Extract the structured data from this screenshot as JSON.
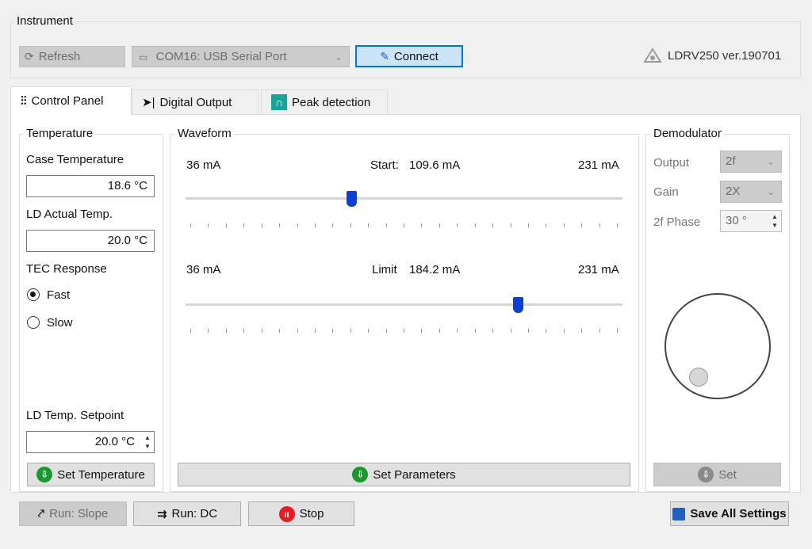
{
  "instrument": {
    "group_title": "Instrument",
    "refresh_label": "Refresh",
    "port_value": "COM16: USB Serial Port",
    "connect_label": "Connect",
    "device_version": "LDRV250 ver.190701"
  },
  "tabs": [
    {
      "label": "Control Panel",
      "icon": "sliders-icon",
      "active": true
    },
    {
      "label": "Digital Output",
      "icon": "diode-icon",
      "active": false
    },
    {
      "label": "Peak detection",
      "icon": "peak-icon",
      "active": false
    }
  ],
  "temperature": {
    "group_title": "Temperature",
    "case_label": "Case Temperature",
    "case_value": "18.6 °C",
    "ld_actual_label": "LD Actual Temp.",
    "ld_actual_value": "20.0 °C",
    "tec_label": "TEC Response",
    "tec_options": [
      "Fast",
      "Slow"
    ],
    "tec_selected": "Fast",
    "setpoint_label": "LD Temp. Setpoint",
    "setpoint_value": "20.0 °C",
    "set_button": "Set Temperature"
  },
  "waveform": {
    "group_title": "Waveform",
    "start": {
      "min": "36 mA",
      "label": "Start:",
      "value": "109.6 mA",
      "max": "231 mA",
      "fraction": 0.38
    },
    "limit": {
      "min": "36 mA",
      "label": "Limit",
      "value": "184.2 mA",
      "max": "231 mA",
      "fraction": 0.76
    },
    "set_button": "Set Parameters"
  },
  "demodulator": {
    "group_title": "Demodulator",
    "output_label": "Output",
    "output_value": "2f",
    "gain_label": "Gain",
    "gain_value": "2X",
    "phase_label": "2f Phase",
    "phase_value": "30 °",
    "set_button": "Set"
  },
  "footer": {
    "run_slope": "Run: Slope",
    "run_dc": "Run: DC",
    "stop": "Stop",
    "save_all": "Save All Settings"
  },
  "colors": {
    "accent": "#0078d7",
    "slider_thumb": "#0a3fd8",
    "green_icon": "#1a9a2e",
    "stop_red": "#e81b23",
    "save_blue": "#1f5fbf"
  }
}
